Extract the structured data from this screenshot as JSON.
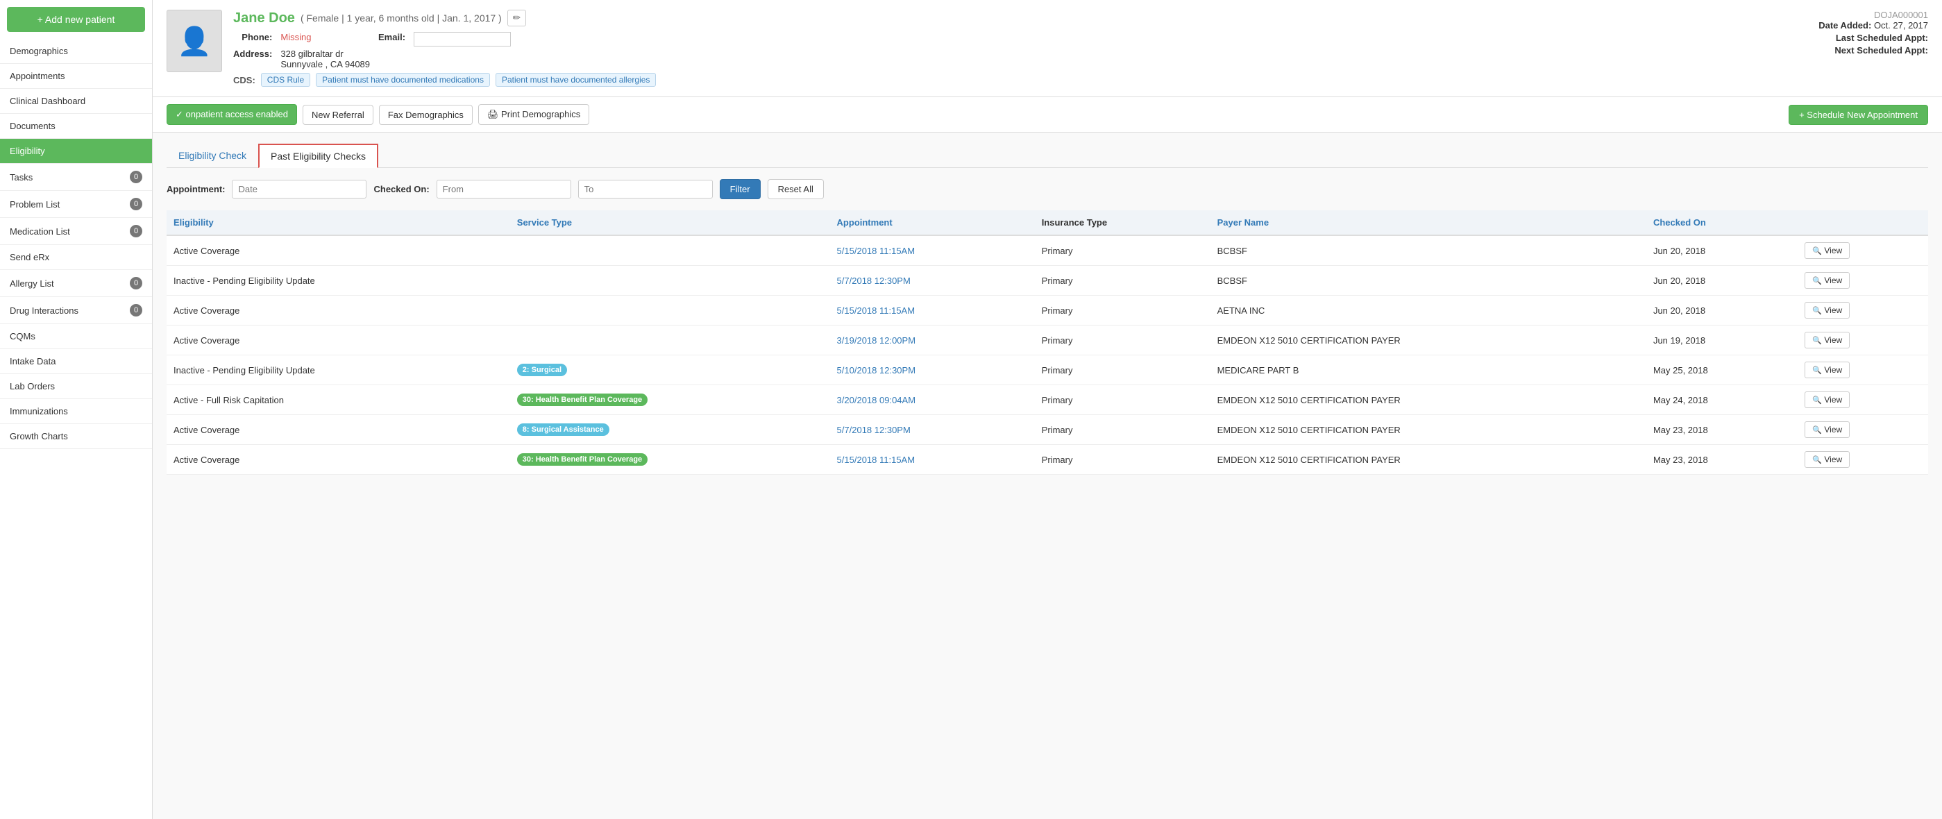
{
  "sidebar": {
    "add_button": "+ Add new patient",
    "items": [
      {
        "label": "Demographics",
        "badge": null,
        "active": false
      },
      {
        "label": "Appointments",
        "badge": null,
        "active": false
      },
      {
        "label": "Clinical Dashboard",
        "badge": null,
        "active": false
      },
      {
        "label": "Documents",
        "badge": null,
        "active": false
      },
      {
        "label": "Eligibility",
        "badge": null,
        "active": true
      },
      {
        "label": "Tasks",
        "badge": "0",
        "active": false
      },
      {
        "label": "Problem List",
        "badge": "0",
        "active": false
      },
      {
        "label": "Medication List",
        "badge": "0",
        "active": false
      },
      {
        "label": "Send eRx",
        "badge": null,
        "active": false
      },
      {
        "label": "Allergy List",
        "badge": "0",
        "active": false
      },
      {
        "label": "Drug Interactions",
        "badge": "0",
        "active": false
      },
      {
        "label": "CQMs",
        "badge": null,
        "active": false
      },
      {
        "label": "Intake Data",
        "badge": null,
        "active": false
      },
      {
        "label": "Lab Orders",
        "badge": null,
        "active": false
      },
      {
        "label": "Immunizations",
        "badge": null,
        "active": false
      },
      {
        "label": "Growth Charts",
        "badge": null,
        "active": false
      }
    ]
  },
  "patient": {
    "name": "Jane Doe",
    "gender": "Female",
    "age": "1 year, 6 months old",
    "dob": "Jan. 1, 2017",
    "id": "DOJA000001",
    "phone": "Missing",
    "email": "",
    "address_line1": "328 gilbraltar dr",
    "address_line2": "Sunnyvale , CA 94089",
    "date_added": "Oct. 27, 2017",
    "last_scheduled_appt": "",
    "next_scheduled_appt": "",
    "cds_label": "CDS:",
    "cds_tags": [
      "CDS Rule",
      "Patient must have documented medications",
      "Patient must have documented allergies"
    ],
    "onpatient_label": "✓ onpatient access enabled",
    "buttons": {
      "new_referral": "New Referral",
      "fax_demographics": "Fax Demographics",
      "print_demographics": "🖨 Print Demographics",
      "schedule_appt": "+ Schedule New Appointment"
    }
  },
  "tabs": {
    "tab1": "Eligibility Check",
    "tab2": "Past Eligibility Checks"
  },
  "filter": {
    "appointment_label": "Appointment:",
    "appointment_placeholder": "Date",
    "checked_on_label": "Checked On:",
    "from_placeholder": "From",
    "to_placeholder": "To",
    "filter_btn": "Filter",
    "reset_btn": "Reset All"
  },
  "table": {
    "columns": [
      {
        "label": "Eligibility",
        "sortable": true
      },
      {
        "label": "Service Type",
        "sortable": true
      },
      {
        "label": "Appointment",
        "sortable": true
      },
      {
        "label": "Insurance Type",
        "sortable": false,
        "bold": true
      },
      {
        "label": "Payer Name",
        "sortable": true
      },
      {
        "label": "Checked On",
        "sortable": true
      }
    ],
    "rows": [
      {
        "eligibility": "Active Coverage",
        "service_type": "",
        "service_badge": null,
        "appointment": "5/15/2018 11:15AM",
        "insurance_type": "Primary",
        "payer_name": "BCBSF",
        "checked_on": "Jun 20, 2018",
        "view_btn": "View"
      },
      {
        "eligibility": "Inactive - Pending Eligibility Update",
        "service_type": "",
        "service_badge": null,
        "appointment": "5/7/2018 12:30PM",
        "insurance_type": "Primary",
        "payer_name": "BCBSF",
        "checked_on": "Jun 20, 2018",
        "view_btn": "View"
      },
      {
        "eligibility": "Active Coverage",
        "service_type": "",
        "service_badge": null,
        "appointment": "5/15/2018 11:15AM",
        "insurance_type": "Primary",
        "payer_name": "AETNA INC",
        "checked_on": "Jun 20, 2018",
        "view_btn": "View"
      },
      {
        "eligibility": "Active Coverage",
        "service_type": "",
        "service_badge": null,
        "appointment": "3/19/2018 12:00PM",
        "insurance_type": "Primary",
        "payer_name": "EMDEON X12 5010 CERTIFICATION PAYER",
        "checked_on": "Jun 19, 2018",
        "view_btn": "View"
      },
      {
        "eligibility": "Inactive - Pending Eligibility Update",
        "service_type": "2: Surgical",
        "service_badge": "surgical",
        "appointment": "5/10/2018 12:30PM",
        "insurance_type": "Primary",
        "payer_name": "MEDICARE PART B",
        "checked_on": "May 25, 2018",
        "view_btn": "View"
      },
      {
        "eligibility": "Active - Full Risk Capitation",
        "service_type": "30: Health Benefit Plan Coverage",
        "service_badge": "health",
        "appointment": "3/20/2018 09:04AM",
        "insurance_type": "Primary",
        "payer_name": "EMDEON X12 5010 CERTIFICATION PAYER",
        "checked_on": "May 24, 2018",
        "view_btn": "View"
      },
      {
        "eligibility": "Active Coverage",
        "service_type": "8: Surgical Assistance",
        "service_badge": "surgical-assist",
        "appointment": "5/7/2018 12:30PM",
        "insurance_type": "Primary",
        "payer_name": "EMDEON X12 5010 CERTIFICATION PAYER",
        "checked_on": "May 23, 2018",
        "view_btn": "View"
      },
      {
        "eligibility": "Active Coverage",
        "service_type": "30: Health Benefit Plan Coverage",
        "service_badge": "health",
        "appointment": "5/15/2018 11:15AM",
        "insurance_type": "Primary",
        "payer_name": "EMDEON X12 5010 CERTIFICATION PAYER",
        "checked_on": "May 23, 2018",
        "view_btn": "View"
      }
    ]
  },
  "icons": {
    "edit": "✏",
    "search": "🔍",
    "print": "🖨"
  }
}
